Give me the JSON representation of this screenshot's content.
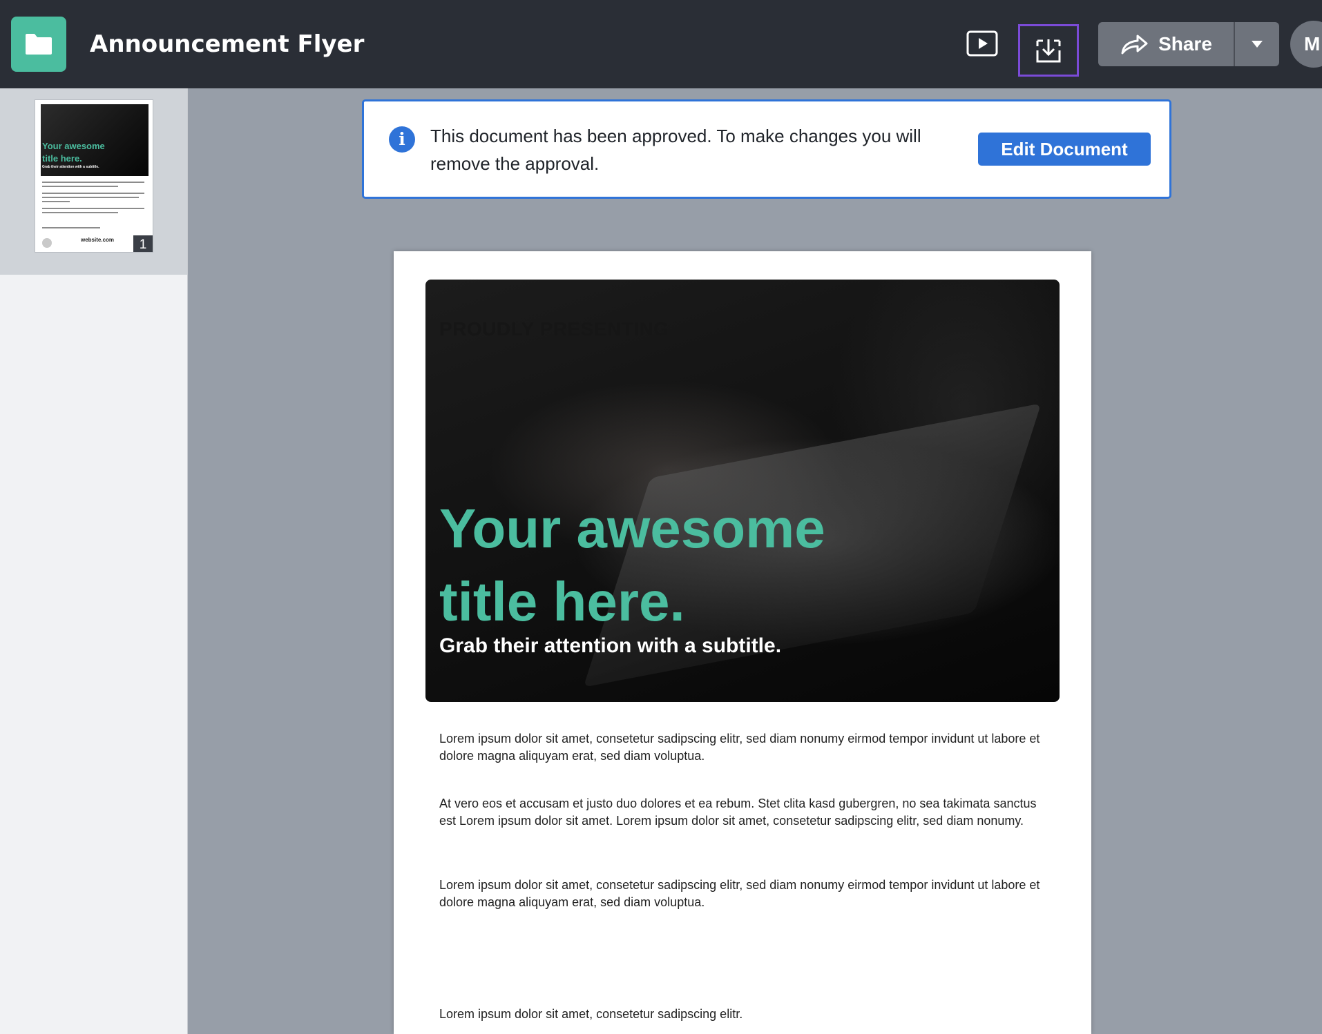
{
  "header": {
    "title": "Announcement Flyer",
    "share_label": "Share",
    "avatar_initial": "M"
  },
  "sidebar": {
    "thumbnail": {
      "page_number": "1",
      "title": "Your awesome title here.",
      "subtitle": "Grab their attention with a subtitle.",
      "website": "website.com"
    }
  },
  "banner": {
    "message": "This document has been approved. To make changes you will remove the approval.",
    "edit_label": "Edit Document"
  },
  "document": {
    "eyebrow": "PROUDLY PRESENTING",
    "title": "Your awesome title here.",
    "subtitle": "Grab their attention with a subtitle.",
    "paragraphs": [
      "Lorem ipsum dolor sit amet, consetetur sadipscing elitr, sed diam nonumy eirmod tempor invidunt ut labore et dolore magna aliquyam erat, sed diam voluptua.",
      "At vero eos et accusam et justo duo dolores et ea rebum. Stet clita kasd gubergren, no sea takimata sanctus est Lorem ipsum dolor sit amet. Lorem ipsum dolor sit amet, consetetur sadipscing elitr, sed diam nonumy.",
      "Lorem ipsum dolor sit amet, consetetur sadipscing elitr, sed diam nonumy eirmod tempor invidunt ut labore et dolore magna aliquyam erat, sed diam voluptua.",
      "Lorem ipsum dolor sit amet, consetetur sadipscing elitr."
    ]
  },
  "icons": {
    "app": "folder-icon",
    "present": "play-icon",
    "download": "download-icon",
    "share": "share-arrow-icon",
    "dropdown": "caret-down-icon",
    "info": "info-icon"
  },
  "colors": {
    "topbar": "#2a2e36",
    "accent_teal": "#4bbd9f",
    "primary_blue": "#2f73d8",
    "download_highlight": "#7b4bd8",
    "workspace": "#979ea8"
  }
}
